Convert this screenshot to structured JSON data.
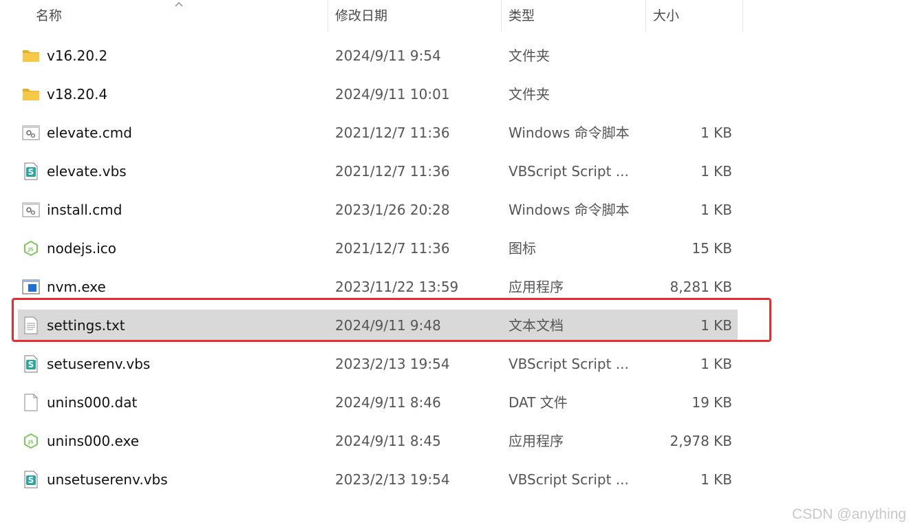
{
  "columns": {
    "name": "名称",
    "modified": "修改日期",
    "type": "类型",
    "size": "大小"
  },
  "files": [
    {
      "name": "v16.20.2",
      "modified": "2024/9/11 9:54",
      "type": "文件夹",
      "size": "",
      "icon": "folder-icon"
    },
    {
      "name": "v18.20.4",
      "modified": "2024/9/11 10:01",
      "type": "文件夹",
      "size": "",
      "icon": "folder-icon"
    },
    {
      "name": "elevate.cmd",
      "modified": "2021/12/7 11:36",
      "type": "Windows 命令脚本",
      "size": "1 KB",
      "icon": "cmd-file-icon"
    },
    {
      "name": "elevate.vbs",
      "modified": "2021/12/7 11:36",
      "type": "VBScript Script ...",
      "size": "1 KB",
      "icon": "vbscript-file-icon"
    },
    {
      "name": "install.cmd",
      "modified": "2023/1/26 20:28",
      "type": "Windows 命令脚本",
      "size": "1 KB",
      "icon": "cmd-file-icon"
    },
    {
      "name": "nodejs.ico",
      "modified": "2021/12/7 11:36",
      "type": "图标",
      "size": "15 KB",
      "icon": "nodejs-icon"
    },
    {
      "name": "nvm.exe",
      "modified": "2023/11/22 13:59",
      "type": "应用程序",
      "size": "8,281 KB",
      "icon": "exe-file-icon"
    },
    {
      "name": "settings.txt",
      "modified": "2024/9/11 9:48",
      "type": "文本文档",
      "size": "1 KB",
      "icon": "text-file-icon",
      "selected": true
    },
    {
      "name": "setuserenv.vbs",
      "modified": "2023/2/13 19:54",
      "type": "VBScript Script ...",
      "size": "1 KB",
      "icon": "vbscript-file-icon"
    },
    {
      "name": "unins000.dat",
      "modified": "2024/9/11 8:46",
      "type": "DAT 文件",
      "size": "19 KB",
      "icon": "blank-file-icon"
    },
    {
      "name": "unins000.exe",
      "modified": "2024/9/11 8:45",
      "type": "应用程序",
      "size": "2,978 KB",
      "icon": "nodejs-icon"
    },
    {
      "name": "unsetuserenv.vbs",
      "modified": "2023/2/13 19:54",
      "type": "VBScript Script ...",
      "size": "1 KB",
      "icon": "vbscript-file-icon"
    }
  ],
  "colors": {
    "highlight_border": "#e82b2b",
    "selected_row": "#d9d9d9",
    "folder": "#f7c948"
  },
  "watermark": "CSDN @anything"
}
